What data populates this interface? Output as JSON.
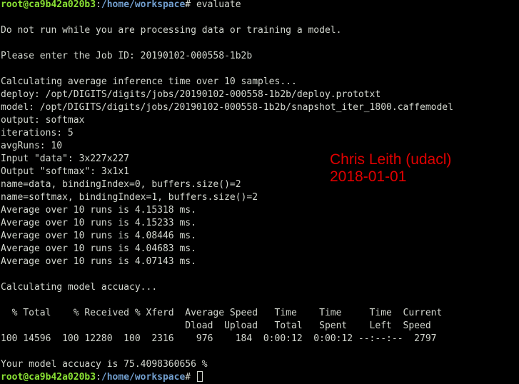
{
  "prompt": {
    "user_host": "root@ca9b42a020b3",
    "separator": ":",
    "path": "/home/workspace",
    "symbol": "# "
  },
  "command": "evaluate",
  "output_lines": [
    "",
    "Do not run while you are processing data or training a model.",
    "",
    "Please enter the Job ID: 20190102-000558-1b2b",
    "",
    "Calculating average inference time over 10 samples...",
    "deploy: /opt/DIGITS/digits/jobs/20190102-000558-1b2b/deploy.prototxt",
    "model: /opt/DIGITS/digits/jobs/20190102-000558-1b2b/snapshot_iter_1800.caffemodel",
    "output: softmax",
    "iterations: 5",
    "avgRuns: 10",
    "Input \"data\": 3x227x227",
    "Output \"softmax\": 3x1x1",
    "name=data, bindingIndex=0, buffers.size()=2",
    "name=softmax, bindingIndex=1, buffers.size()=2",
    "Average over 10 runs is 4.15318 ms.",
    "Average over 10 runs is 4.15233 ms.",
    "Average over 10 runs is 4.08446 ms.",
    "Average over 10 runs is 4.04683 ms.",
    "Average over 10 runs is 4.07143 ms.",
    "",
    "Calculating model accuacy...",
    "",
    "  % Total    % Received % Xferd  Average Speed   Time    Time     Time  Current",
    "                                 Dload  Upload   Total   Spent    Left  Speed",
    "100 14596  100 12280  100  2316    976    184  0:00:12  0:00:12 --:--:--  2797",
    "",
    "Your model accuacy is 75.4098360656 %"
  ],
  "watermark": {
    "line1": "Chris Leith (udacl)",
    "line2": "2018-01-01"
  },
  "colors": {
    "background": "#000000",
    "text": "#d3d7cf",
    "prompt_user": "#8ae234",
    "prompt_path": "#729fcf",
    "watermark": "#e00000"
  }
}
